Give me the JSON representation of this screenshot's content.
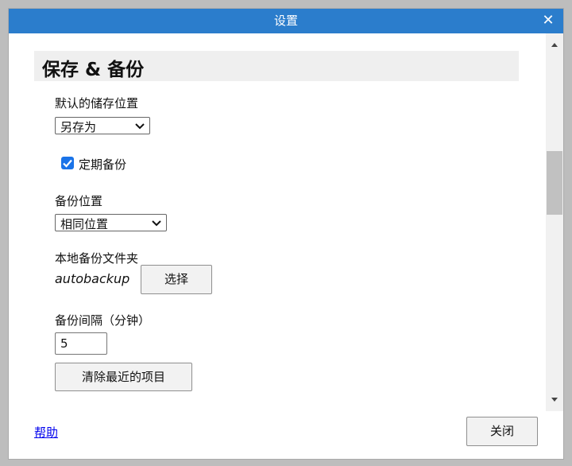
{
  "window": {
    "title": "设置",
    "close_glyph": "✕"
  },
  "section": {
    "title": "保存 & 备份"
  },
  "default_save_location": {
    "label": "默认的储存位置",
    "selected": "另存为"
  },
  "periodic_backup": {
    "label": "定期备份",
    "checked": true
  },
  "backup_location": {
    "label": "备份位置",
    "selected": "相同位置"
  },
  "local_backup_folder": {
    "label": "本地备份文件夹",
    "value": "autobackup",
    "choose_button": "选择"
  },
  "backup_interval": {
    "label": "备份间隔（分钟）",
    "value": "5"
  },
  "clear_recent_button": "清除最近的项目",
  "footer": {
    "help_link": "帮助",
    "close_button": "关闭"
  },
  "colors": {
    "titlebar": "#2b7dcc",
    "checkbox": "#1a73e8",
    "link": "#0000ee"
  }
}
